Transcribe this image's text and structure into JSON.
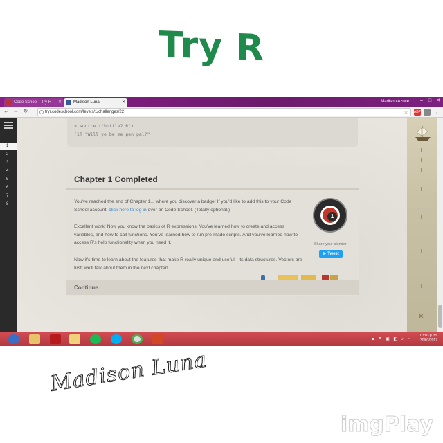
{
  "overlay": {
    "title": "Try R",
    "signature": "Madison Luna",
    "watermark": "imgPlay"
  },
  "browser": {
    "tabs": [
      {
        "label": "Code School - Try R",
        "icon": "code-school-favicon"
      },
      {
        "label": "Madison Luna",
        "icon": "facebook-favicon"
      }
    ],
    "user_name": "Madison Azuce...",
    "url": "tryr.codeschool.com/levels/1/challenges/22"
  },
  "sidebar": {
    "levels": [
      "1",
      "2",
      "3",
      "4",
      "5",
      "6",
      "7",
      "8"
    ],
    "active_level": "1"
  },
  "console": {
    "lines": [
      "> source (\"bottle2.R\")",
      "[1] \"Will ye be me pen pal?\""
    ]
  },
  "chapter": {
    "title": "Chapter 1 Completed",
    "para1_before": "You've reached the end of Chapter 1... where you discover a badge! If you'd like to add this to your Code School account, ",
    "para1_link": "click here to log in",
    "para1_after": " over on Code School. (Totally optional.)",
    "para2": "Excellent work! Now you know the basics of R expressions. You've learned how to create and access variables, and how to call functions. You've learned how to run pre-made scripts. And you've learned how to access R's help functionality when you need it.",
    "para3": "Now it's time to learn about the features that make R really unique and useful - its data structures. Vectors are first; we'll talk about them in the next chapter!",
    "badge_number": "1",
    "share_label": "Share your plunder:",
    "tweet_label": "Tweet",
    "continue_label": "Continue"
  },
  "taskbar": {
    "time": "03:03 p. m.",
    "date": "30/03/2017"
  },
  "colors": {
    "title_green": "#1f8a4c",
    "tab_purple": "#7a1f7a",
    "taskbar_red": "#c0424a",
    "link_blue": "#3b87c8",
    "tweet_blue": "#1da1f2"
  }
}
